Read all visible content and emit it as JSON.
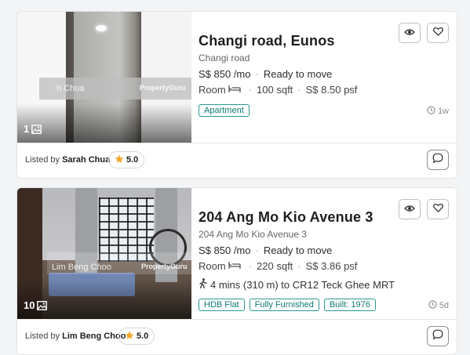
{
  "listings": [
    {
      "title": "Changi road, Eunos",
      "address": "Changi road",
      "price": "S$ 850 /mo",
      "availability": "Ready to move",
      "room_type": "Room",
      "size": "100 sqft",
      "psf": "S$ 8.50 psf",
      "badges": [
        "Apartment"
      ],
      "posted_ago": "1w",
      "photo_count": "1",
      "watermark_agent": "h Chua",
      "watermark_brand": "PropertyGuru",
      "lister_prefix": "Listed by",
      "lister_name": "Sarah Chua",
      "rating": "5.0"
    },
    {
      "title": "204 Ang Mo Kio Avenue 3",
      "address": "204 Ang Mo Kio Avenue 3",
      "price": "S$ 850 /mo",
      "availability": "Ready to move",
      "room_type": "Room",
      "size": "220 sqft",
      "psf": "S$ 3.86 psf",
      "mrt": "4 mins (310 m) to CR12 Teck Ghee MRT",
      "badges": [
        "HDB Flat",
        "Fully Furnished",
        "Built: 1976"
      ],
      "posted_ago": "5d",
      "photo_count": "10",
      "watermark_agent": "Lim Beng Choo",
      "watermark_brand": "PropertyGuru",
      "lister_prefix": "Listed by",
      "lister_name": "Lim Beng Choo",
      "rating": "5.0"
    }
  ],
  "icons": {
    "view": "eye-icon",
    "favourite": "heart-icon",
    "chat": "chat-bubble-icon",
    "star": "star-icon",
    "clock": "clock-icon",
    "photos": "image-icon",
    "bed": "bed-icon",
    "walk": "walking-person-icon"
  },
  "colors": {
    "badge": "#0d7a72",
    "star": "#f5a623",
    "card_background": "#ffffff",
    "page_background": "#f3f4f5"
  }
}
